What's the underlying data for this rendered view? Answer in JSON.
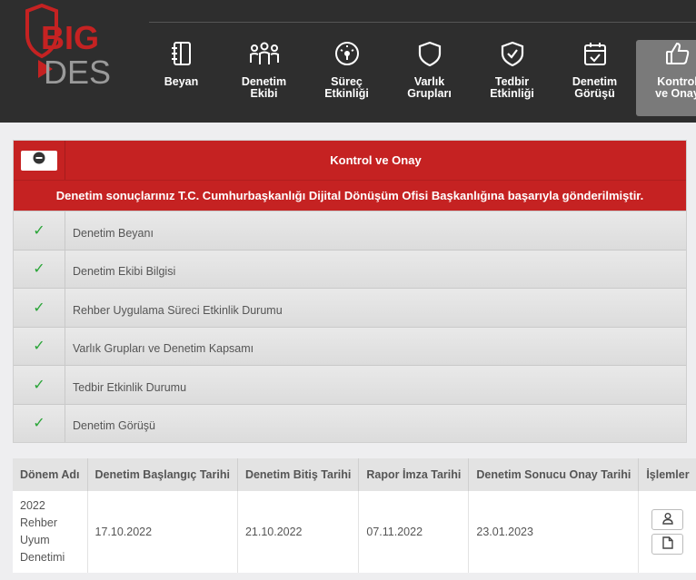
{
  "brand": {
    "line1": "BIG",
    "line2": "DES",
    "accent": "#c52222"
  },
  "nav": [
    {
      "label": "Beyan",
      "icon": "notebook-icon",
      "active": false
    },
    {
      "label": "Denetim\nEkibi",
      "icon": "team-icon",
      "active": false
    },
    {
      "label": "Süreç\nEtkinliği",
      "icon": "gauge-icon",
      "active": false
    },
    {
      "label": "Varlık\nGrupları",
      "icon": "shield-icon",
      "active": false
    },
    {
      "label": "Tedbir\nEtkinliği",
      "icon": "shield-check-icon",
      "active": false
    },
    {
      "label": "Denetim\nGörüşü",
      "icon": "calendar-check-icon",
      "active": false
    },
    {
      "label": "Kontrol\nve Onay",
      "icon": "thumbs-up-icon",
      "active": true
    }
  ],
  "panel": {
    "title": "Kontrol ve Onay",
    "banner": "Denetim sonuçlarınız T.C. Cumhurbaşkanlığı Dijital Dönüşüm Ofisi Başkanlığına başarıyla gönderilmiştir.",
    "check_mark": "✓",
    "items": [
      {
        "label": "Denetim Beyanı"
      },
      {
        "label": "Denetim Ekibi Bilgisi"
      },
      {
        "label": "Rehber Uygulama Süreci Etkinlik Durumu"
      },
      {
        "label": "Varlık Grupları ve Denetim Kapsamı"
      },
      {
        "label": "Tedbir Etkinlik Durumu"
      },
      {
        "label": "Denetim Görüşü"
      }
    ]
  },
  "table": {
    "headers": [
      "Dönem Adı",
      "Denetim Başlangıç Tarihi",
      "Denetim Bitiş Tarihi",
      "Rapor İmza Tarihi",
      "Denetim Sonucu Onay Tarihi",
      "İşlemler"
    ],
    "rows": [
      {
        "name": "2022\nRehber\nUyum\nDenetimi",
        "start": "17.10.2022",
        "end": "21.10.2022",
        "signed": "07.11.2022",
        "approved": "23.01.2023"
      }
    ]
  }
}
